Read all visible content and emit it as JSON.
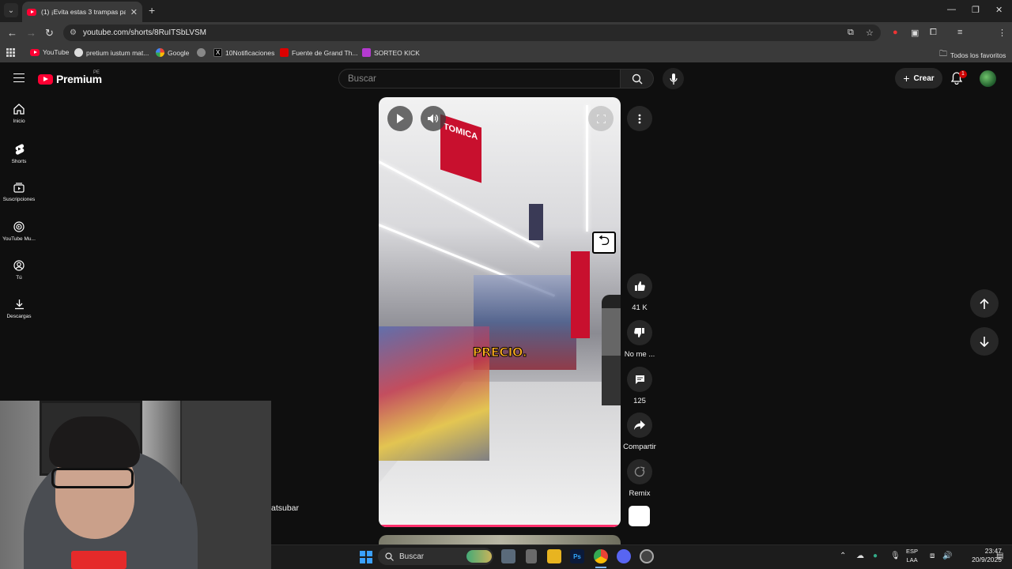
{
  "browser": {
    "tab_title": "(1) ¡Evita estas 3 trampas para t",
    "url": "youtube.com/shorts/8RuITSbLVSM",
    "bookmarks": [
      "YouTube",
      "pretium iustum mat...",
      "Google",
      "10Notificaciones",
      "Fuente de Grand Th...",
      "SORTEO KICK"
    ],
    "all_bookmarks": "Todos los favoritos"
  },
  "header": {
    "logo": "Premium",
    "region": "PE",
    "search_placeholder": "Buscar",
    "create_label": "Crear",
    "notification_count": "1"
  },
  "sidebar": {
    "items": [
      {
        "label": "Inicio",
        "icon": "home-icon"
      },
      {
        "label": "Shorts",
        "icon": "shorts-icon"
      },
      {
        "label": "Suscripciones",
        "icon": "subscriptions-icon"
      },
      {
        "label": "YouTube Mu...",
        "icon": "music-icon"
      },
      {
        "label": "Tú",
        "icon": "user-icon"
      },
      {
        "label": "Descargas",
        "icon": "download-icon"
      }
    ]
  },
  "video": {
    "caption": "PRECIO.",
    "sign_text": "TOMICA",
    "progress": 1.0
  },
  "actions": {
    "likes": "41 K",
    "dislike": "No me ...",
    "comments": "125",
    "share": "Compartir",
    "remix": "Remix"
  },
  "overlay": {
    "comment_name": "atsubar"
  },
  "taskbar": {
    "search": "Buscar",
    "lang_line1": "ESP",
    "lang_line2": "LAA",
    "time": "23:47",
    "date": "20/9/2025"
  },
  "colors": {
    "brand_red": "#ff0033",
    "background": "#0f0f0f",
    "progress": "#ff2f6d"
  }
}
